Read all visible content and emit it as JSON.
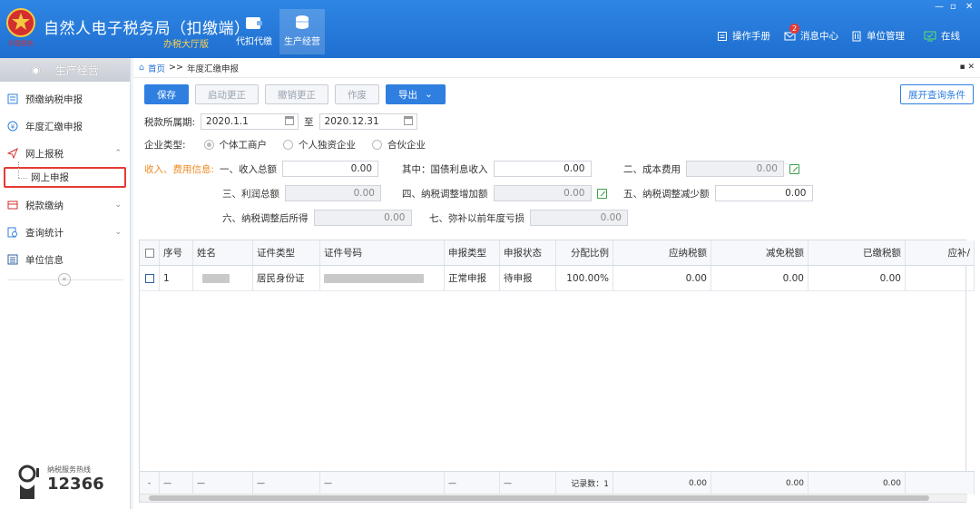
{
  "header": {
    "app_title": "自然人电子税务局（扣缴端）",
    "app_subtitle": "办税大厅版",
    "emblem_text": "中国税务",
    "modules": [
      {
        "label": "代扣代缴"
      },
      {
        "label": "生产经营"
      }
    ],
    "right_items": [
      {
        "label": "操作手册"
      },
      {
        "label": "消息中心",
        "badge": "2"
      },
      {
        "label": "单位管理"
      },
      {
        "label": "在线"
      }
    ]
  },
  "sidebar": {
    "title": "生产经营",
    "items": [
      {
        "label": "预缴纳税申报"
      },
      {
        "label": "年度汇缴申报"
      },
      {
        "label": "网上报税"
      },
      {
        "label": "网上申报"
      },
      {
        "label": "税款缴纳"
      },
      {
        "label": "查询统计"
      },
      {
        "label": "单位信息"
      }
    ],
    "collapse": "«",
    "hotline_label": "纳税服务热线",
    "hotline_number": "12366"
  },
  "breadcrumb": {
    "home": "首页",
    "sep": ">>",
    "current": "年度汇缴申报"
  },
  "toolbar": {
    "save": "保存",
    "start_correction": "启动更正",
    "cancel_correction": "撤销更正",
    "void": "作废",
    "export": "导出",
    "expand_query": "展开查询条件"
  },
  "form": {
    "period_label": "税款所属期:",
    "period_from": "2020.1.1",
    "period_to_label": "至",
    "period_to": "2020.12.31",
    "enterprise_type_label": "企业类型:",
    "enterprise_types": [
      "个体工商户",
      "个人独资企业",
      "合伙企业"
    ],
    "income_label": "收入、费用信息:",
    "fields": {
      "total_income": {
        "label": "一、收入总额",
        "value": "0.00"
      },
      "bond_interest": {
        "label": "其中：国债利息收入",
        "value": "0.00"
      },
      "cost": {
        "label": "二、成本费用",
        "value": "0.00"
      },
      "total_profit": {
        "label": "三、利润总额",
        "value": "0.00"
      },
      "tax_adjust_increase": {
        "label": "四、纳税调整增加额",
        "value": "0.00"
      },
      "tax_adjust_decrease": {
        "label": "五、纳税调整减少额",
        "value": "0.00"
      },
      "adjusted_income": {
        "label": "六、纳税调整后所得",
        "value": "0.00"
      },
      "prior_loss": {
        "label": "七、弥补以前年度亏损",
        "value": "0.00"
      }
    }
  },
  "table": {
    "columns": [
      "序号",
      "姓名",
      "证件类型",
      "证件号码",
      "申报类型",
      "申报状态",
      "分配比例",
      "应纳税额",
      "减免税额",
      "已缴税额",
      "应补/"
    ],
    "rows": [
      {
        "no": "1",
        "id_type": "居民身份证",
        "report_type": "正常申报",
        "report_status": "待申报",
        "ratio": "100.00%",
        "tax_payable": "0.00",
        "tax_reduction": "0.00",
        "tax_paid": "0.00"
      }
    ],
    "footer": {
      "dash": "—",
      "record_count": "记录数：1",
      "tax_payable": "0.00",
      "tax_reduction": "0.00",
      "tax_paid": "0.00"
    }
  }
}
